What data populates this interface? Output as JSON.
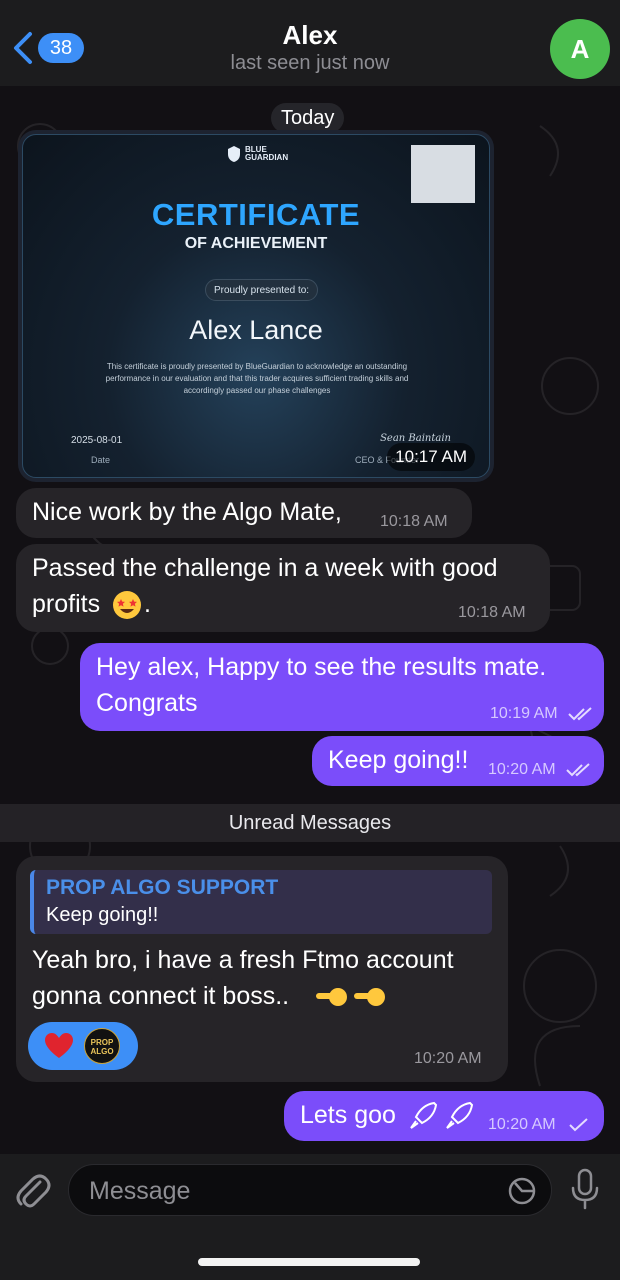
{
  "header": {
    "back_count": "38",
    "title": "Alex",
    "subtitle": "last seen just now",
    "avatar_initial": "A"
  },
  "chat": {
    "date_label": "Today",
    "certificate": {
      "logo_line1": "BLUE",
      "logo_line2": "GUARDIAN",
      "heading": "CERTIFICATE",
      "subheading": "OF ACHIEVEMENT",
      "presented_label": "Proudly presented to:",
      "recipient": "Alex Lance",
      "description": "This certificate is proudly presented by BlueGuardian to acknowledge an outstanding performance in our evaluation and that this trader acquires sufficient trading skills and accordingly passed our phase challenges",
      "date_value": "2025-08-01",
      "date_label": "Date",
      "signature": "Sean Baintain",
      "signer_title": "CEO & Founder",
      "time": "10:17 AM"
    },
    "messages": [
      {
        "text": "Nice work by the Algo Mate,",
        "time": "10:18 AM"
      },
      {
        "line1": "Passed the challenge in a week with good",
        "line2": "profits",
        "line2_tail": ".",
        "time": "10:18 AM"
      },
      {
        "line1": "Hey alex, Happy to see the results mate.",
        "line2": "Congrats",
        "time": "10:19 AM"
      },
      {
        "text": "Keep going!!",
        "time": "10:20 AM"
      },
      {
        "reply_name": "PROP ALGO SUPPORT",
        "reply_text": "Keep going!!",
        "line1": "Yeah bro, i have a fresh Ftmo account",
        "line2": "gonna connect it boss..",
        "time": "10:20 AM",
        "badge_line1": "PROP",
        "badge_line2": "ALGO"
      },
      {
        "text": "Lets goo",
        "time": "10:20 AM"
      }
    ],
    "unread_label": "Unread Messages"
  },
  "composer": {
    "placeholder": "Message"
  },
  "colors": {
    "outgoing_bubble": "#7b4dfa",
    "incoming_bubble": "#262428",
    "accent_blue": "#3d8ff7",
    "avatar_green": "#4bbd4f"
  },
  "icons": [
    "chevron-left-icon",
    "attach-icon",
    "sticker-icon",
    "microphone-icon",
    "double-check-icon",
    "heart-icon",
    "rocket-icon",
    "star-struck-emoji",
    "pointing-hand-emoji"
  ]
}
